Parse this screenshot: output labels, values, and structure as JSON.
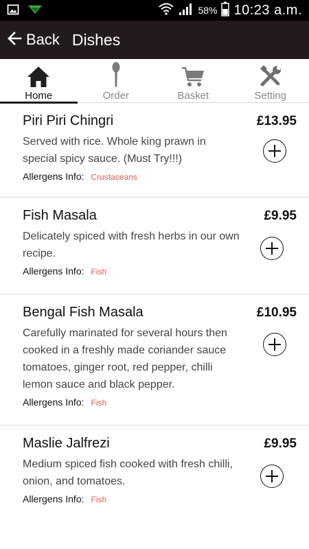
{
  "status_bar": {
    "battery_percent": "58%",
    "time": "10:23 a.m.",
    "icons": [
      "image-icon",
      "download-icon",
      "wifi-icon",
      "signal-icon",
      "battery-icon"
    ]
  },
  "app_bar": {
    "back_label": "Back",
    "title": "Dishes",
    "background": "#231a1c"
  },
  "tabs": [
    {
      "label": "Home",
      "icon": "home-icon",
      "active": true
    },
    {
      "label": "Order",
      "icon": "spoon-icon",
      "active": false
    },
    {
      "label": "Basket",
      "icon": "cart-icon",
      "active": false
    },
    {
      "label": "Setting",
      "icon": "tools-icon",
      "active": false
    }
  ],
  "allergens_label": "Allergens Info:",
  "allergen_color": "#e05a4f",
  "dishes": [
    {
      "name": "Piri Piri Chingri",
      "price": "£13.95",
      "description": "Served with rice. Whole king prawn in special spicy sauce. (Must Try!!!)",
      "allergens": "Crustaceans"
    },
    {
      "name": "Fish Masala",
      "price": "£9.95",
      "description": "Delicately spiced with fresh herbs in our own recipe.",
      "allergens": "Fish"
    },
    {
      "name": "Bengal Fish Masala",
      "price": "£10.95",
      "description": "Carefully marinated for several hours then cooked in a freshly made coriander sauce tomatoes, ginger root, red pepper, chilli lemon sauce and black pepper.",
      "allergens": "Fish"
    },
    {
      "name": "Maslie Jalfrezi",
      "price": "£9.95",
      "description": "Medium spiced fish cooked with fresh chilli, onion, and tomatoes.",
      "allergens": "Fish"
    }
  ]
}
